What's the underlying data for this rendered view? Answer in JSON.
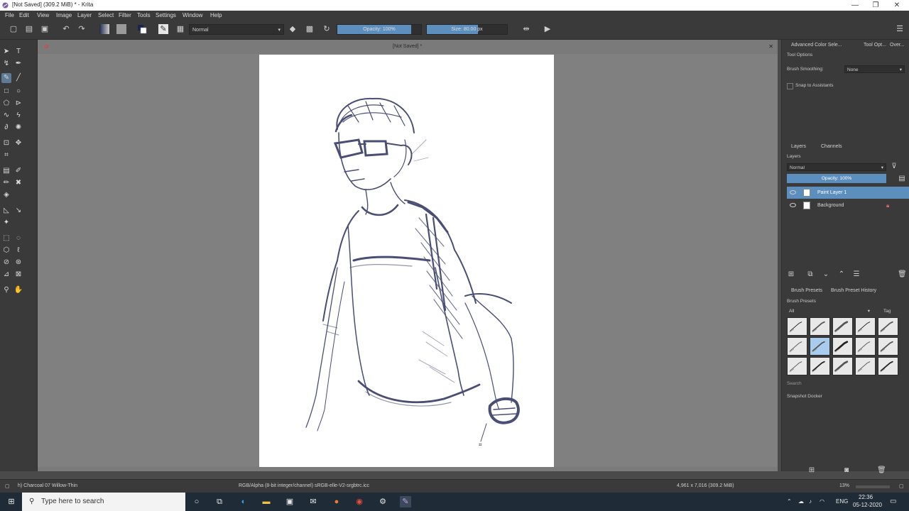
{
  "titlebar": {
    "title": "[Not Saved]  (309.2 MiB)  * - Krita",
    "minimize": "—",
    "restore": "❐",
    "close": "✕"
  },
  "menu": [
    "File",
    "Edit",
    "View",
    "Image",
    "Layer",
    "Select",
    "Filter",
    "Tools",
    "Settings",
    "Window",
    "Help"
  ],
  "toolbar": {
    "blend_mode": "Normal",
    "opacity_label": "Opacity: 100%",
    "opacity_value": 1.0,
    "size_label": "Size:  80.00 px"
  },
  "document": {
    "tab_title": "[Not Saved] *"
  },
  "docker": {
    "top_tabs": [
      "Advanced Color Sele...",
      "Tool Opt...",
      "Over..."
    ],
    "tool_options_title": "Tool Options",
    "brush_smoothing_label": "Brush Smoothing:",
    "brush_smoothing_value": "None",
    "snap_label": "Snap to Assistants",
    "layers_tabs": [
      "Layers",
      "Channels"
    ],
    "layers_title": "Layers",
    "layers_blend": "Normal",
    "layers_opacity": "Opacity:  100%",
    "layers": [
      {
        "name": "Paint Layer 1",
        "selected": true
      },
      {
        "name": "Background",
        "selected": false
      }
    ],
    "brush_tabs": [
      "Brush Presets",
      "Brush Preset History"
    ],
    "brush_presets_title": "Brush Presets",
    "brush_filter": "All",
    "brush_tag": "Tag",
    "search_placeholder": "Search",
    "snapshot_title": "Snapshot Docker"
  },
  "status": {
    "brush": "h) Charcoal 07 Willow-Thin",
    "color_space": "RGB/Alpha (8-bit integer/channel)  sRGB-elle-V2-srgbtrc.icc",
    "dimensions": "4,961 x 7,016 (309.2 MiB)",
    "zoom": "13%"
  },
  "taskbar": {
    "search_placeholder": "Type here to search",
    "language": "ENG",
    "time": "22:36",
    "date": "05-12-2020"
  },
  "colors": {
    "accent": "#5d8fbe",
    "panel": "#3a3a3a",
    "canvas_bg": "#808080",
    "ink": "#2b2f5c"
  }
}
